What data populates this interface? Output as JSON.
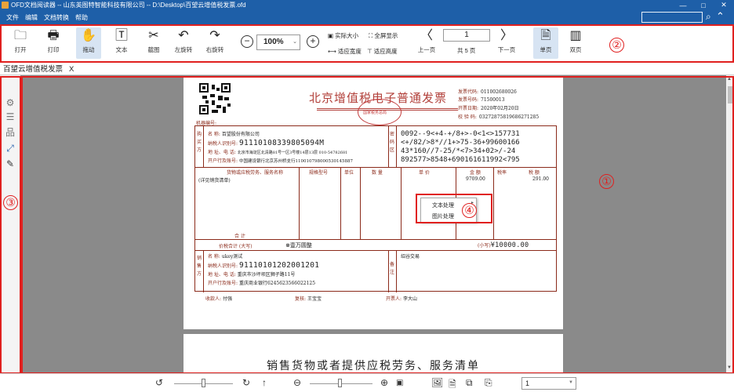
{
  "window": {
    "title": "OFD文档阅读器 -- 山东英图特智能科技有限公司 -- D:\\Desktop\\百望云增值税发票.ofd",
    "minimize": "—",
    "maximize": "□",
    "close": "✕"
  },
  "menu": {
    "items": [
      "文件",
      "编辑",
      "文档转换",
      "帮助"
    ],
    "search_placeholder": ""
  },
  "toolbar": {
    "open": "打开",
    "print": "打印",
    "drag": "拖动",
    "text": "文本",
    "screenshot": "截图",
    "rotate_left": "左旋转",
    "rotate_right": "右旋转",
    "zoom_value": "100%",
    "actual_size": "实际大小",
    "fullscreen": "全屏显示",
    "fit_width": "适应宽度",
    "fit_height": "适应高度",
    "prev_page": "上一页",
    "page_number": "1",
    "page_total": "共 5 页",
    "next_page": "下一页",
    "single_page": "单页",
    "double_page": "双页"
  },
  "tab": {
    "label": "百望云增值税发票",
    "close": "X"
  },
  "annotations": [
    "①",
    "②",
    "③",
    "④",
    "②"
  ],
  "invoice": {
    "title": "北京增值税电子普通发票",
    "seal_text": "国家税务总局",
    "invoice_code_label": "发票代码:",
    "invoice_code": "011002680026",
    "invoice_no_label": "发票号码:",
    "invoice_no": "71500013",
    "date_label": "开票日期:",
    "date": "2020年02月20日",
    "check_code_label": "校 验 码:",
    "check_code": "03272875819686271285",
    "machine_no_label": "机器编号:",
    "buyer_label": "购买方",
    "buyer_name_label": "名        称:",
    "buyer_name": "百望股份有限公司",
    "buyer_tax_label": "纳税人识别号:",
    "buyer_tax": "91110108339805094M",
    "buyer_addr_label": "地 址、电 话:",
    "buyer_addr": "北京市海淀区北清路81号一区3号楼14层13层 010-54782681",
    "buyer_bank_label": "开户行及账号:",
    "buyer_bank": "中国建设银行北京苏州桥支行110010798000530145887",
    "cipher_label": "密码区",
    "cipher": "0092--9<+4-+/8+>-0<1<>157731\n<+/82/>8*//1+>75-36+99600166\n43*160//7-25/*<7>34+02>/-24\n892577>8548+690161611992<795",
    "col_item": "货物或应税劳务、服务名称",
    "col_spec": "规格型号",
    "col_unit": "单位",
    "col_qty": "数 量",
    "col_price": "单 价",
    "col_amount": "金 额",
    "col_rate": "税率",
    "col_tax": "税 额",
    "item_name": "(详见销货清单)",
    "item_amount": "9709.00",
    "item_tax": "291.00",
    "total_label": "合        计",
    "total_tax_label": "价税合计 (大写)",
    "total_words": "⊗壹万圆整",
    "total_small_label": "(小写)",
    "total_small": "¥10000.00",
    "seller_label": "销售方",
    "seller_name_label": "名        称:",
    "seller_name": "ukey测试",
    "seller_tax_label": "纳税人识别号:",
    "seller_tax": "91110101202001201",
    "seller_addr_label": "地 址、电 话:",
    "seller_addr": "重庆市沙坪坝区狮子路11号",
    "seller_bank_label": "开户行及账号:",
    "seller_bank": "重庆商业银行6245623566022125",
    "remark_label": "备注",
    "remark": "绍谷交易",
    "payee_label": "收款人:",
    "payee": "付强",
    "reviewer_label": "复核:",
    "reviewer": "王宝宝",
    "issuer_label": "开票人:",
    "issuer": "李大山"
  },
  "page2": {
    "subtitle": "销售货物或者提供应税劳务、服务清单"
  },
  "context_menu": {
    "items": [
      "文本处理",
      "图片处理"
    ]
  },
  "bottombar": {
    "page_select": "1"
  }
}
